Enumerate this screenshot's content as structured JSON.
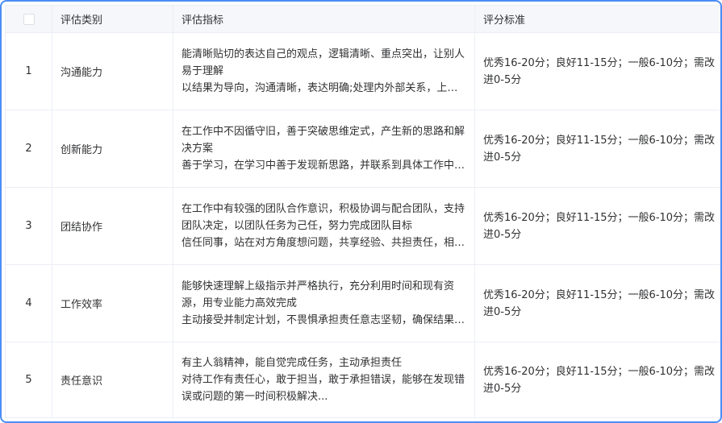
{
  "header": {
    "category": "评估类别",
    "criteria": "评估指标",
    "standard": "评分标准"
  },
  "rows": [
    {
      "index": "1",
      "category": "沟通能力",
      "line1": "能清晰贴切的表达自己的观点，逻辑清晰、重点突出，让别人易于理解",
      "line2": "以结果为导向，沟通清晰，表达明确;处理内外部关系，上下…",
      "standard": "优秀16-20分；良好11-15分；一般6-10分；需改进0-5分"
    },
    {
      "index": "2",
      "category": "创新能力",
      "line1": "在工作中不因循守旧，善于突破思维定式，产生新的思路和解决方案",
      "line2": "善于学习，在学习中善于发现新思路，并联系到具体工作中…",
      "standard": "优秀16-20分；良好11-15分；一般6-10分；需改进0-5分"
    },
    {
      "index": "3",
      "category": "团结协作",
      "line1": "在工作中有较强的团队合作意识，积极协调与配合团队，支持团队决定，以团队任务为己任，努力完成团队目标",
      "line2": "信任同事，站在对方角度想问题，共享经验、共担责任，相…",
      "standard": "优秀16-20分；良好11-15分；一般6-10分；需改进0-5分"
    },
    {
      "index": "4",
      "category": "工作效率",
      "line1": "能够快速理解上级指示并严格执行，充分利用时间和现有资源，用专业能力高效完成",
      "line2": "主动接受并制定计划，不畏惧承担责任意志坚韧，确保结果…",
      "standard": "优秀16-20分；良好11-15分；一般6-10分；需改进0-5分"
    },
    {
      "index": "5",
      "category": "责任意识",
      "line1": "有主人翁精神，能自觉完成任务，主动承担责任",
      "line2": "对待工作有责任心，敢于担当，敢于承担错误，能够在发现错误或问题的第一时间积极解决...",
      "standard": "优秀16-20分；良好11-15分；一般6-10分；需改进0-5分"
    }
  ]
}
